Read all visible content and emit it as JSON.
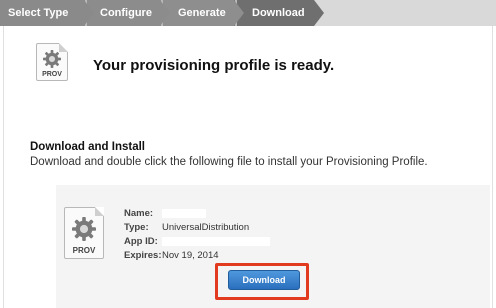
{
  "steps": [
    {
      "label": "Select Type"
    },
    {
      "label": "Configure"
    },
    {
      "label": "Generate"
    },
    {
      "label": "Download"
    }
  ],
  "header": {
    "icon_label": "PROV",
    "headline": "Your provisioning profile is ready."
  },
  "section": {
    "title": "Download and Install",
    "description": "Download and double click the following file to install your Provisioning Profile."
  },
  "profile": {
    "icon_label": "PROV",
    "name_label": "Name:",
    "name_value": "",
    "type_label": "Type:",
    "type_value": "UniversalDistribution",
    "appid_label": "App ID:",
    "appid_value": "",
    "expires_label": "Expires:",
    "expires_value": "Nov 19, 2014"
  },
  "download_button": {
    "label": "Download"
  },
  "colors": {
    "highlight": "#e23a1e",
    "button": "#3a82cf",
    "active_step": "#6f6f6f"
  },
  "icons": [
    "gear-icon",
    "file-icon"
  ]
}
